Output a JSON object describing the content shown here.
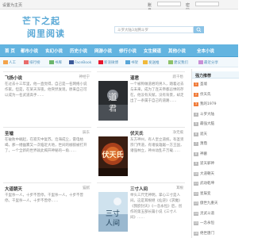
{
  "topbar": {
    "home_label": "设置为主页",
    "account_label": "账号",
    "password_label": "密码"
  },
  "header": {
    "logo_line1": "芒下之起",
    "logo_line2": "阅里阅读",
    "search_placeholder": "斗罗大陆3龙腾斗罗"
  },
  "nav": {
    "items": [
      "首 页",
      "都市小说",
      "玄幻小说",
      "历史小说",
      "网游小说",
      "修行小说",
      "女生频道",
      "其他小说",
      "全本小说"
    ]
  },
  "subbar": {
    "items": [
      "人工",
      "排行榜",
      "书库",
      "FaceBook",
      "新浪微博",
      "书架",
      "发送推",
      "建议我们",
      "最近分享"
    ]
  },
  "panels": [
    {
      "title": "飞扬小说",
      "author": "神经宁",
      "desc": "在过去十三年里，他一直觉得，自己是一名网络小说作家。但是，在某天深夜，他突然发现，原来自己可以成为一名武道高手……"
    },
    {
      "title": "道君",
      "author": "跃千愁",
      "desc": "一个被称做道君的男人，踏着过去与未来，成为了连天帝都忌惮的存在。他没有天赋，没有背景，却走出了一条属于自己的道路……"
    },
    {
      "title": "圣墟",
      "author": "辰东",
      "desc": "在破败中崛起，在寂灭中复苏。沧海成尘，雷电枯竭，那一缕幽雾又一次临近大地，世间的枷锁被打开了，一个全新的世界就此揭开神秘的一角……"
    },
    {
      "title": "伏天氏",
      "author": "净无痕",
      "desc": "东方神州，有人皇立道统，有圣贤宗门传道，有诸侯雄踞一方王国，诸强林立，神州动乱千万载……"
    },
    {
      "title": "大道朝天",
      "author": "猫腻",
      "desc": "千里杀一人，十步不曾停。千里杀一人，十步不曾停。千里杀一人，十步不曾停……"
    },
    {
      "title": "三寸人间",
      "author": "耳根",
      "desc": "举头三尺无神明，掌心三寸是人间。这是耳根继《仙逆》《求魔》《我欲封天》《一念永恒》后，创作的第五部长篇小说《三寸人间》……"
    }
  ],
  "ranking": {
    "title": "强力推荐",
    "items": [
      "圣墟",
      "伏天氏",
      "我的1979",
      "斗罗大陆",
      "最强大脑",
      "遮天",
      "萧鼎",
      "神墓",
      "逆天邪神",
      "大道朝天",
      "武动乾坤",
      "星辰变",
      "傲世九重天",
      "灵武斗道",
      "一念永恒",
      "绝世唐门"
    ]
  }
}
